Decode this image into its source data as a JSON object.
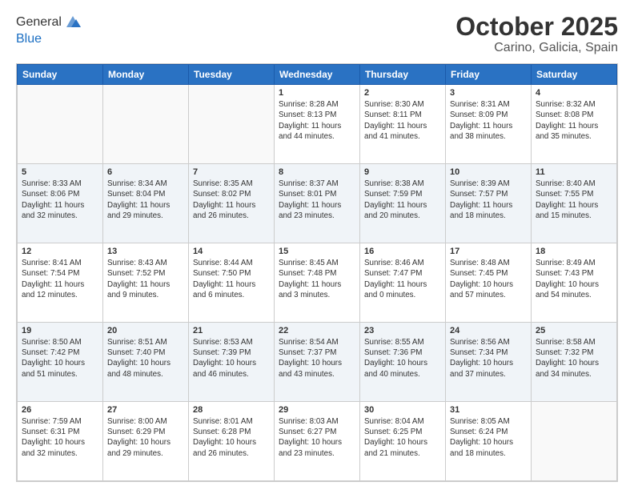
{
  "header": {
    "logo_line1": "General",
    "logo_line2": "Blue",
    "title": "October 2025",
    "subtitle": "Carino, Galicia, Spain"
  },
  "days_of_week": [
    "Sunday",
    "Monday",
    "Tuesday",
    "Wednesday",
    "Thursday",
    "Friday",
    "Saturday"
  ],
  "weeks": [
    [
      {
        "day": "",
        "sunrise": "",
        "sunset": "",
        "daylight": ""
      },
      {
        "day": "",
        "sunrise": "",
        "sunset": "",
        "daylight": ""
      },
      {
        "day": "",
        "sunrise": "",
        "sunset": "",
        "daylight": ""
      },
      {
        "day": "1",
        "sunrise": "Sunrise: 8:28 AM",
        "sunset": "Sunset: 8:13 PM",
        "daylight": "Daylight: 11 hours and 44 minutes."
      },
      {
        "day": "2",
        "sunrise": "Sunrise: 8:30 AM",
        "sunset": "Sunset: 8:11 PM",
        "daylight": "Daylight: 11 hours and 41 minutes."
      },
      {
        "day": "3",
        "sunrise": "Sunrise: 8:31 AM",
        "sunset": "Sunset: 8:09 PM",
        "daylight": "Daylight: 11 hours and 38 minutes."
      },
      {
        "day": "4",
        "sunrise": "Sunrise: 8:32 AM",
        "sunset": "Sunset: 8:08 PM",
        "daylight": "Daylight: 11 hours and 35 minutes."
      }
    ],
    [
      {
        "day": "5",
        "sunrise": "Sunrise: 8:33 AM",
        "sunset": "Sunset: 8:06 PM",
        "daylight": "Daylight: 11 hours and 32 minutes."
      },
      {
        "day": "6",
        "sunrise": "Sunrise: 8:34 AM",
        "sunset": "Sunset: 8:04 PM",
        "daylight": "Daylight: 11 hours and 29 minutes."
      },
      {
        "day": "7",
        "sunrise": "Sunrise: 8:35 AM",
        "sunset": "Sunset: 8:02 PM",
        "daylight": "Daylight: 11 hours and 26 minutes."
      },
      {
        "day": "8",
        "sunrise": "Sunrise: 8:37 AM",
        "sunset": "Sunset: 8:01 PM",
        "daylight": "Daylight: 11 hours and 23 minutes."
      },
      {
        "day": "9",
        "sunrise": "Sunrise: 8:38 AM",
        "sunset": "Sunset: 7:59 PM",
        "daylight": "Daylight: 11 hours and 20 minutes."
      },
      {
        "day": "10",
        "sunrise": "Sunrise: 8:39 AM",
        "sunset": "Sunset: 7:57 PM",
        "daylight": "Daylight: 11 hours and 18 minutes."
      },
      {
        "day": "11",
        "sunrise": "Sunrise: 8:40 AM",
        "sunset": "Sunset: 7:55 PM",
        "daylight": "Daylight: 11 hours and 15 minutes."
      }
    ],
    [
      {
        "day": "12",
        "sunrise": "Sunrise: 8:41 AM",
        "sunset": "Sunset: 7:54 PM",
        "daylight": "Daylight: 11 hours and 12 minutes."
      },
      {
        "day": "13",
        "sunrise": "Sunrise: 8:43 AM",
        "sunset": "Sunset: 7:52 PM",
        "daylight": "Daylight: 11 hours and 9 minutes."
      },
      {
        "day": "14",
        "sunrise": "Sunrise: 8:44 AM",
        "sunset": "Sunset: 7:50 PM",
        "daylight": "Daylight: 11 hours and 6 minutes."
      },
      {
        "day": "15",
        "sunrise": "Sunrise: 8:45 AM",
        "sunset": "Sunset: 7:48 PM",
        "daylight": "Daylight: 11 hours and 3 minutes."
      },
      {
        "day": "16",
        "sunrise": "Sunrise: 8:46 AM",
        "sunset": "Sunset: 7:47 PM",
        "daylight": "Daylight: 11 hours and 0 minutes."
      },
      {
        "day": "17",
        "sunrise": "Sunrise: 8:48 AM",
        "sunset": "Sunset: 7:45 PM",
        "daylight": "Daylight: 10 hours and 57 minutes."
      },
      {
        "day": "18",
        "sunrise": "Sunrise: 8:49 AM",
        "sunset": "Sunset: 7:43 PM",
        "daylight": "Daylight: 10 hours and 54 minutes."
      }
    ],
    [
      {
        "day": "19",
        "sunrise": "Sunrise: 8:50 AM",
        "sunset": "Sunset: 7:42 PM",
        "daylight": "Daylight: 10 hours and 51 minutes."
      },
      {
        "day": "20",
        "sunrise": "Sunrise: 8:51 AM",
        "sunset": "Sunset: 7:40 PM",
        "daylight": "Daylight: 10 hours and 48 minutes."
      },
      {
        "day": "21",
        "sunrise": "Sunrise: 8:53 AM",
        "sunset": "Sunset: 7:39 PM",
        "daylight": "Daylight: 10 hours and 46 minutes."
      },
      {
        "day": "22",
        "sunrise": "Sunrise: 8:54 AM",
        "sunset": "Sunset: 7:37 PM",
        "daylight": "Daylight: 10 hours and 43 minutes."
      },
      {
        "day": "23",
        "sunrise": "Sunrise: 8:55 AM",
        "sunset": "Sunset: 7:36 PM",
        "daylight": "Daylight: 10 hours and 40 minutes."
      },
      {
        "day": "24",
        "sunrise": "Sunrise: 8:56 AM",
        "sunset": "Sunset: 7:34 PM",
        "daylight": "Daylight: 10 hours and 37 minutes."
      },
      {
        "day": "25",
        "sunrise": "Sunrise: 8:58 AM",
        "sunset": "Sunset: 7:32 PM",
        "daylight": "Daylight: 10 hours and 34 minutes."
      }
    ],
    [
      {
        "day": "26",
        "sunrise": "Sunrise: 7:59 AM",
        "sunset": "Sunset: 6:31 PM",
        "daylight": "Daylight: 10 hours and 32 minutes."
      },
      {
        "day": "27",
        "sunrise": "Sunrise: 8:00 AM",
        "sunset": "Sunset: 6:29 PM",
        "daylight": "Daylight: 10 hours and 29 minutes."
      },
      {
        "day": "28",
        "sunrise": "Sunrise: 8:01 AM",
        "sunset": "Sunset: 6:28 PM",
        "daylight": "Daylight: 10 hours and 26 minutes."
      },
      {
        "day": "29",
        "sunrise": "Sunrise: 8:03 AM",
        "sunset": "Sunset: 6:27 PM",
        "daylight": "Daylight: 10 hours and 23 minutes."
      },
      {
        "day": "30",
        "sunrise": "Sunrise: 8:04 AM",
        "sunset": "Sunset: 6:25 PM",
        "daylight": "Daylight: 10 hours and 21 minutes."
      },
      {
        "day": "31",
        "sunrise": "Sunrise: 8:05 AM",
        "sunset": "Sunset: 6:24 PM",
        "daylight": "Daylight: 10 hours and 18 minutes."
      },
      {
        "day": "",
        "sunrise": "",
        "sunset": "",
        "daylight": ""
      }
    ]
  ]
}
